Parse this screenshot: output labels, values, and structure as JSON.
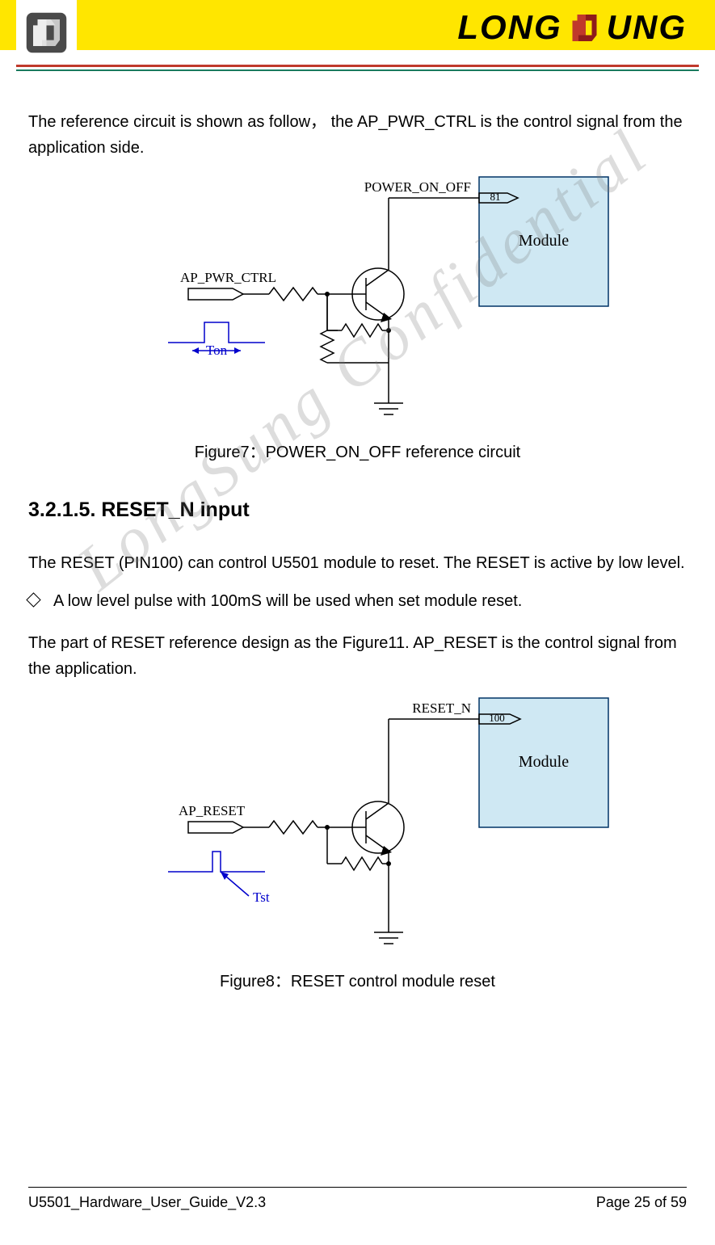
{
  "header": {
    "brand_left": "LONG",
    "brand_right": "UNG"
  },
  "content": {
    "para1": "The reference circuit is shown as follow，  the AP_PWR_CTRL is the control signal from the application side.",
    "fig7": {
      "signal_top": "POWER_ON_OFF",
      "pin_top": "81",
      "input": "AP_PWR_CTRL",
      "timing": "Ton",
      "module": "Module",
      "caption": "Figure7：POWER_ON_OFF reference circuit"
    },
    "section_heading": "3.2.1.5. RESET_N input",
    "para2": "The RESET (PIN100) can control U5501 module to reset. The RESET is active by low level.",
    "bullet": "A low level pulse with 100mS will be used when set module reset.",
    "para3": "The part of RESET reference design as the Figure11. AP_RESET is the control signal from the application.",
    "fig8": {
      "signal_top": "RESET_N",
      "pin_top": "100",
      "input": "AP_RESET",
      "timing": "Tst",
      "module": "Module",
      "caption": "Figure8：RESET control module reset"
    }
  },
  "footer": {
    "doc": "U5501_Hardware_User_Guide_V2.3",
    "page": "Page 25 of 59"
  },
  "watermark": "LongSung Confidential"
}
